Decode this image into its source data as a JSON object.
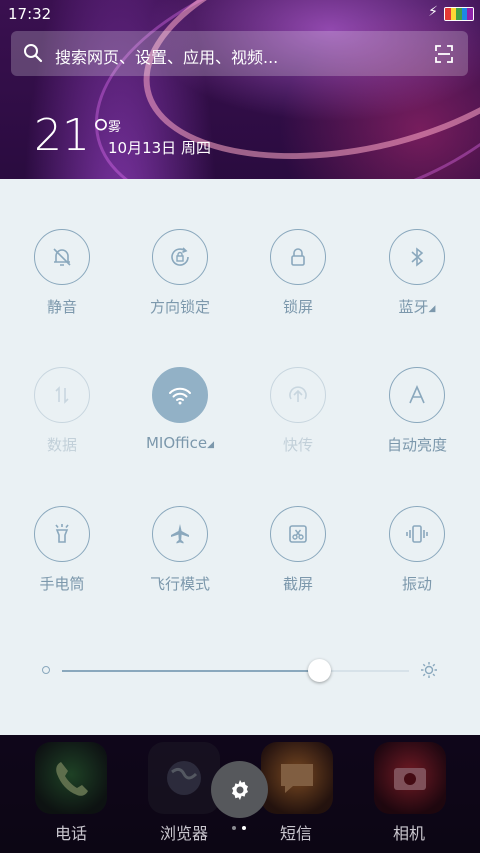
{
  "status_bar": {
    "time": "17:32",
    "charging_glyph": "⚡"
  },
  "search": {
    "placeholder": "搜索网页、设置、应用、视频..."
  },
  "weather": {
    "temperature": "21°",
    "condition": "雾",
    "date": "10月13日 周四"
  },
  "quick_settings": {
    "tiles": [
      {
        "label": "静音",
        "icon": "bell-off-icon",
        "state": "off"
      },
      {
        "label": "方向锁定",
        "icon": "rotation-lock-icon",
        "state": "off"
      },
      {
        "label": "锁屏",
        "icon": "lock-icon",
        "state": "off"
      },
      {
        "label": "蓝牙",
        "icon": "bluetooth-icon",
        "state": "off",
        "has_menu": true
      },
      {
        "label": "数据",
        "icon": "mobile-data-icon",
        "state": "disabled"
      },
      {
        "label": "MIOffice",
        "icon": "wifi-icon",
        "state": "on",
        "has_menu": true
      },
      {
        "label": "快传",
        "icon": "quick-transfer-icon",
        "state": "disabled"
      },
      {
        "label": "自动亮度",
        "icon": "auto-brightness-icon",
        "state": "off"
      },
      {
        "label": "手电筒",
        "icon": "flashlight-icon",
        "state": "off"
      },
      {
        "label": "飞行模式",
        "icon": "airplane-icon",
        "state": "off"
      },
      {
        "label": "截屏",
        "icon": "screenshot-icon",
        "state": "off"
      },
      {
        "label": "振动",
        "icon": "vibrate-icon",
        "state": "off"
      }
    ],
    "brightness_level": 0.74
  },
  "dock": {
    "apps": [
      {
        "label": "电话",
        "icon": "phone-icon",
        "color": "#2e7d32"
      },
      {
        "label": "浏览器",
        "icon": "browser-icon",
        "color": "#2a2a3a"
      },
      {
        "label": "短信",
        "icon": "message-icon",
        "color": "#c6761c"
      },
      {
        "label": "相机",
        "icon": "camera-icon",
        "color": "#b71c1c"
      }
    ],
    "page_indicator": {
      "pages": 2,
      "current": 2
    }
  },
  "colors": {
    "panel_bg": "#eaf1f4",
    "tile_accent": "#8aa8bd",
    "active_tile": "#92b1c6"
  }
}
